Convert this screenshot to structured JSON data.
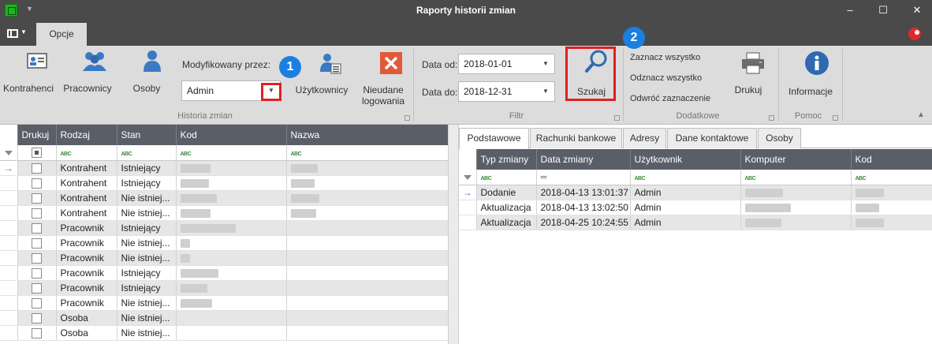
{
  "window": {
    "title": "Raporty historii zmian",
    "controls": [
      "–",
      "☐",
      "✕"
    ]
  },
  "tabs": {
    "active": "Opcje"
  },
  "ribbon": {
    "historia": {
      "group_label": "Historia zmian",
      "kontrahenci": "Kontrahenci",
      "pracownicy": "Pracownicy",
      "osoby": "Osoby",
      "modified_by_label": "Modyfikowany przez:",
      "modified_by_value": "Admin",
      "uzytkownicy": "Użytkownicy",
      "nieudane_line1": "Nieudane",
      "nieudane_line2": "logowania"
    },
    "filtr": {
      "group_label": "Filtr",
      "date_from_label": "Data od:",
      "date_from_value": "2018-01-01",
      "date_to_label": "Data do:",
      "date_to_value": "2018-12-31",
      "search": "Szukaj"
    },
    "dodatkowe": {
      "group_label": "Dodatkowe",
      "select_all": "Zaznacz wszystko",
      "deselect_all": "Odznacz wszystko",
      "invert": "Odwróć zaznaczenie",
      "print": "Drukuj"
    },
    "pomoc": {
      "group_label": "Pomoc",
      "info": "Informacje"
    },
    "badges": [
      "1",
      "2"
    ]
  },
  "left_grid": {
    "columns": [
      "Drukuj",
      "Rodzaj",
      "Stan",
      "Kod",
      "Nazwa"
    ],
    "rows": [
      {
        "rodzaj": "Kontrahent",
        "stan": "Istniejący"
      },
      {
        "rodzaj": "Kontrahent",
        "stan": "Istniejący"
      },
      {
        "rodzaj": "Kontrahent",
        "stan": "Nie istniej..."
      },
      {
        "rodzaj": "Kontrahent",
        "stan": "Nie istniej..."
      },
      {
        "rodzaj": "Pracownik",
        "stan": "Istniejący"
      },
      {
        "rodzaj": "Pracownik",
        "stan": "Nie istniej..."
      },
      {
        "rodzaj": "Pracownik",
        "stan": "Nie istniej..."
      },
      {
        "rodzaj": "Pracownik",
        "stan": "Istniejący"
      },
      {
        "rodzaj": "Pracownik",
        "stan": "Istniejący"
      },
      {
        "rodzaj": "Pracownik",
        "stan": "Nie istniej..."
      },
      {
        "rodzaj": "Osoba",
        "stan": "Nie istniej..."
      },
      {
        "rodzaj": "Osoba",
        "stan": "Nie istniej..."
      }
    ]
  },
  "right_tabs": [
    "Podstawowe",
    "Rachunki bankowe",
    "Adresy",
    "Dane kontaktowe",
    "Osoby"
  ],
  "right_grid": {
    "columns": [
      "Typ zmiany",
      "Data zmiany",
      "Użytkownik",
      "Komputer",
      "Kod"
    ],
    "rows": [
      {
        "typ": "Dodanie",
        "data": "2018-04-13 13:01:37",
        "user": "Admin"
      },
      {
        "typ": "Aktualizacja",
        "data": "2018-04-13 13:02:50",
        "user": "Admin"
      },
      {
        "typ": "Aktualizacja",
        "data": "2018-04-25 10:24:55",
        "user": "Admin"
      }
    ]
  },
  "colors": {
    "title_bar": "#4a4a4a",
    "ribbon": "#dcdcdc",
    "grid_header": "#5a5e66",
    "highlight": "#e02020",
    "badge": "#1a7fe0"
  }
}
